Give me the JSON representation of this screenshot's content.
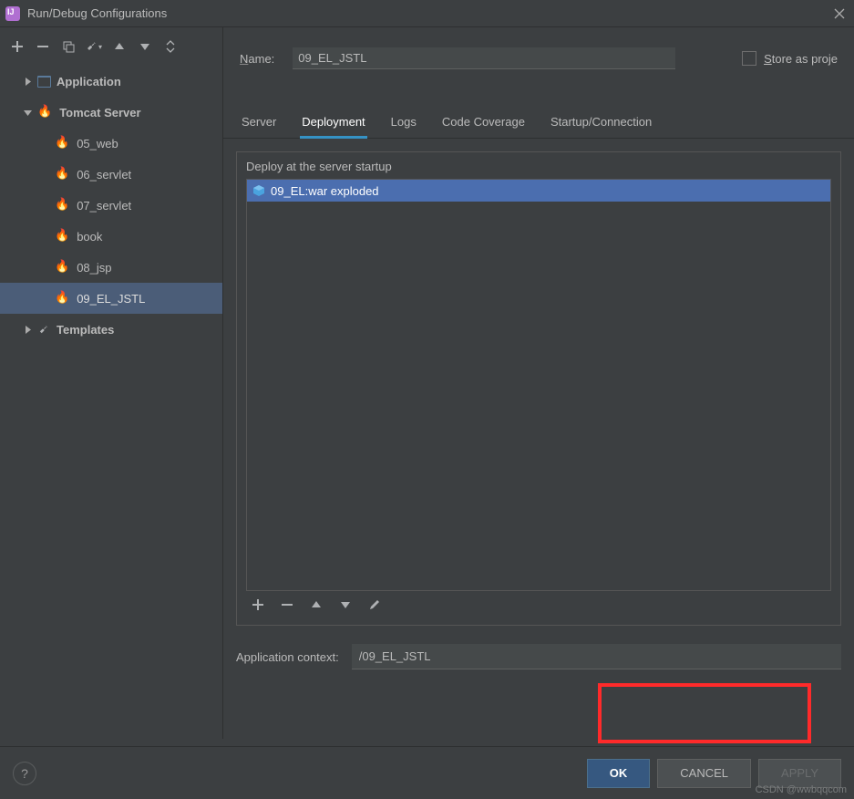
{
  "window": {
    "title": "Run/Debug Configurations",
    "close_icon": "×"
  },
  "sidebar": {
    "nodes": [
      {
        "label": "Application",
        "type": "app",
        "expandable": true,
        "expanded": false
      },
      {
        "label": "Tomcat Server",
        "type": "tomcat",
        "expandable": true,
        "expanded": true,
        "children": [
          {
            "label": "05_web"
          },
          {
            "label": "06_servlet"
          },
          {
            "label": "07_servlet"
          },
          {
            "label": "book"
          },
          {
            "label": "08_jsp"
          },
          {
            "label": "09_EL_JSTL",
            "selected": true
          }
        ]
      },
      {
        "label": "Templates",
        "type": "templates",
        "expandable": true,
        "expanded": false
      }
    ]
  },
  "name_field": {
    "label": "Name:",
    "value": "09_EL_JSTL"
  },
  "store_checkbox": {
    "label": "Store as proje"
  },
  "tabs": [
    {
      "label": "Server"
    },
    {
      "label": "Deployment",
      "active": true
    },
    {
      "label": "Logs"
    },
    {
      "label": "Code Coverage"
    },
    {
      "label": "Startup/Connection"
    }
  ],
  "deployment": {
    "section_title": "Deploy at the server startup",
    "items": [
      {
        "label": "09_EL:war exploded"
      }
    ]
  },
  "app_context": {
    "label": "Application context:",
    "value": "/09_EL_JSTL"
  },
  "footer": {
    "ok": "OK",
    "cancel": "CANCEL",
    "apply": "APPLY"
  },
  "watermark": "CSDN @wwbqqcom"
}
